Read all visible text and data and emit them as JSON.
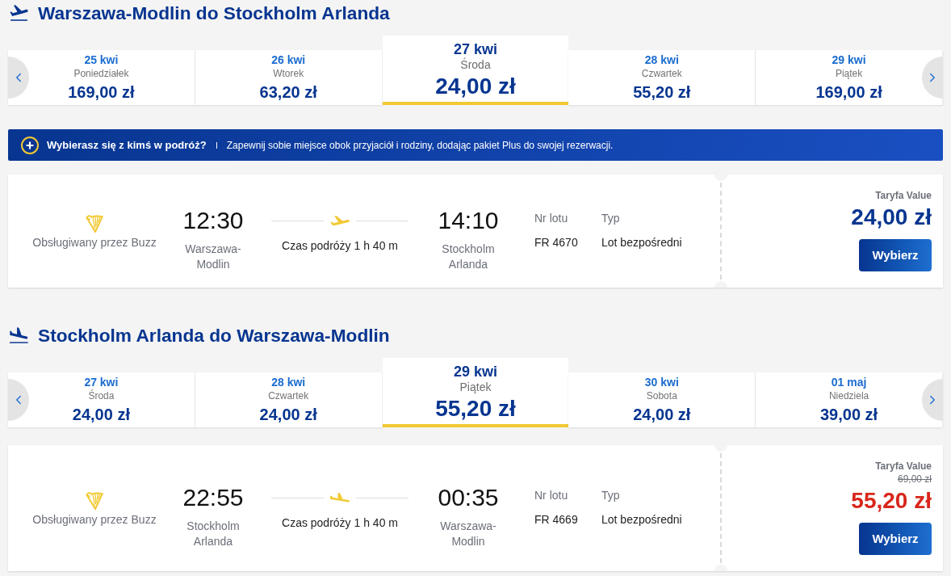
{
  "sections": [
    {
      "kind": "outbound",
      "title": "Warszawa-Modlin do Stockholm Arlanda",
      "dates": [
        {
          "date": "25 kwi",
          "day": "Poniedziałek",
          "price": "169,00 zł",
          "selected": false
        },
        {
          "date": "26 kwi",
          "day": "Wtorek",
          "price": "63,20 zł",
          "selected": false
        },
        {
          "date": "27 kwi",
          "day": "Środa",
          "price": "24,00 zł",
          "selected": true
        },
        {
          "date": "28 kwi",
          "day": "Czwartek",
          "price": "55,20 zł",
          "selected": false
        },
        {
          "date": "29 kwi",
          "day": "Piątek",
          "price": "169,00 zł",
          "selected": false
        }
      ],
      "banner": {
        "title": "Wybierasz się z kimś w podróż?",
        "text": "Zapewnij sobie miejsce obok przyjaciół i rodziny, dodając pakiet Plus do swojej rezerwacji."
      },
      "flight": {
        "operator": "Obsługiwany przez Buzz",
        "departure_time": "12:30",
        "departure_airport": "Warszawa-Modlin",
        "duration": "Czas podróży 1 h 40 m",
        "arrival_time": "14:10",
        "arrival_airport": "Stockholm Arlanda",
        "flight_number_label": "Nr lotu",
        "flight_number": "FR 4670",
        "type_label": "Typ",
        "type": "Lot bezpośredni",
        "fare": "Taryfa Value",
        "price": "24,00 zł",
        "button": "Wybierz"
      }
    },
    {
      "kind": "return",
      "title": "Stockholm Arlanda do Warszawa-Modlin",
      "dates": [
        {
          "date": "27 kwi",
          "day": "Środa",
          "price": "24,00 zł",
          "selected": false
        },
        {
          "date": "28 kwi",
          "day": "Czwartek",
          "price": "24,00 zł",
          "selected": false
        },
        {
          "date": "29 kwi",
          "day": "Piątek",
          "price": "55,20 zł",
          "selected": true
        },
        {
          "date": "30 kwi",
          "day": "Sobota",
          "price": "24,00 zł",
          "selected": false
        },
        {
          "date": "01 maj",
          "day": "Niedziela",
          "price": "39,00 zł",
          "selected": false
        }
      ],
      "flight": {
        "operator": "Obsługiwany przez Buzz",
        "departure_time": "22:55",
        "departure_airport": "Stockholm Arlanda",
        "duration": "Czas podróży 1 h 40 m",
        "arrival_time": "00:35",
        "arrival_airport": "Warszawa-Modlin",
        "flight_number_label": "Nr lotu",
        "flight_number": "FR 4669",
        "type_label": "Typ",
        "type": "Lot bezpośredni",
        "fare": "Taryfa Value",
        "old_price": "69,00 zł",
        "price": "55,20 zł",
        "button": "Wybierz"
      }
    }
  ]
}
